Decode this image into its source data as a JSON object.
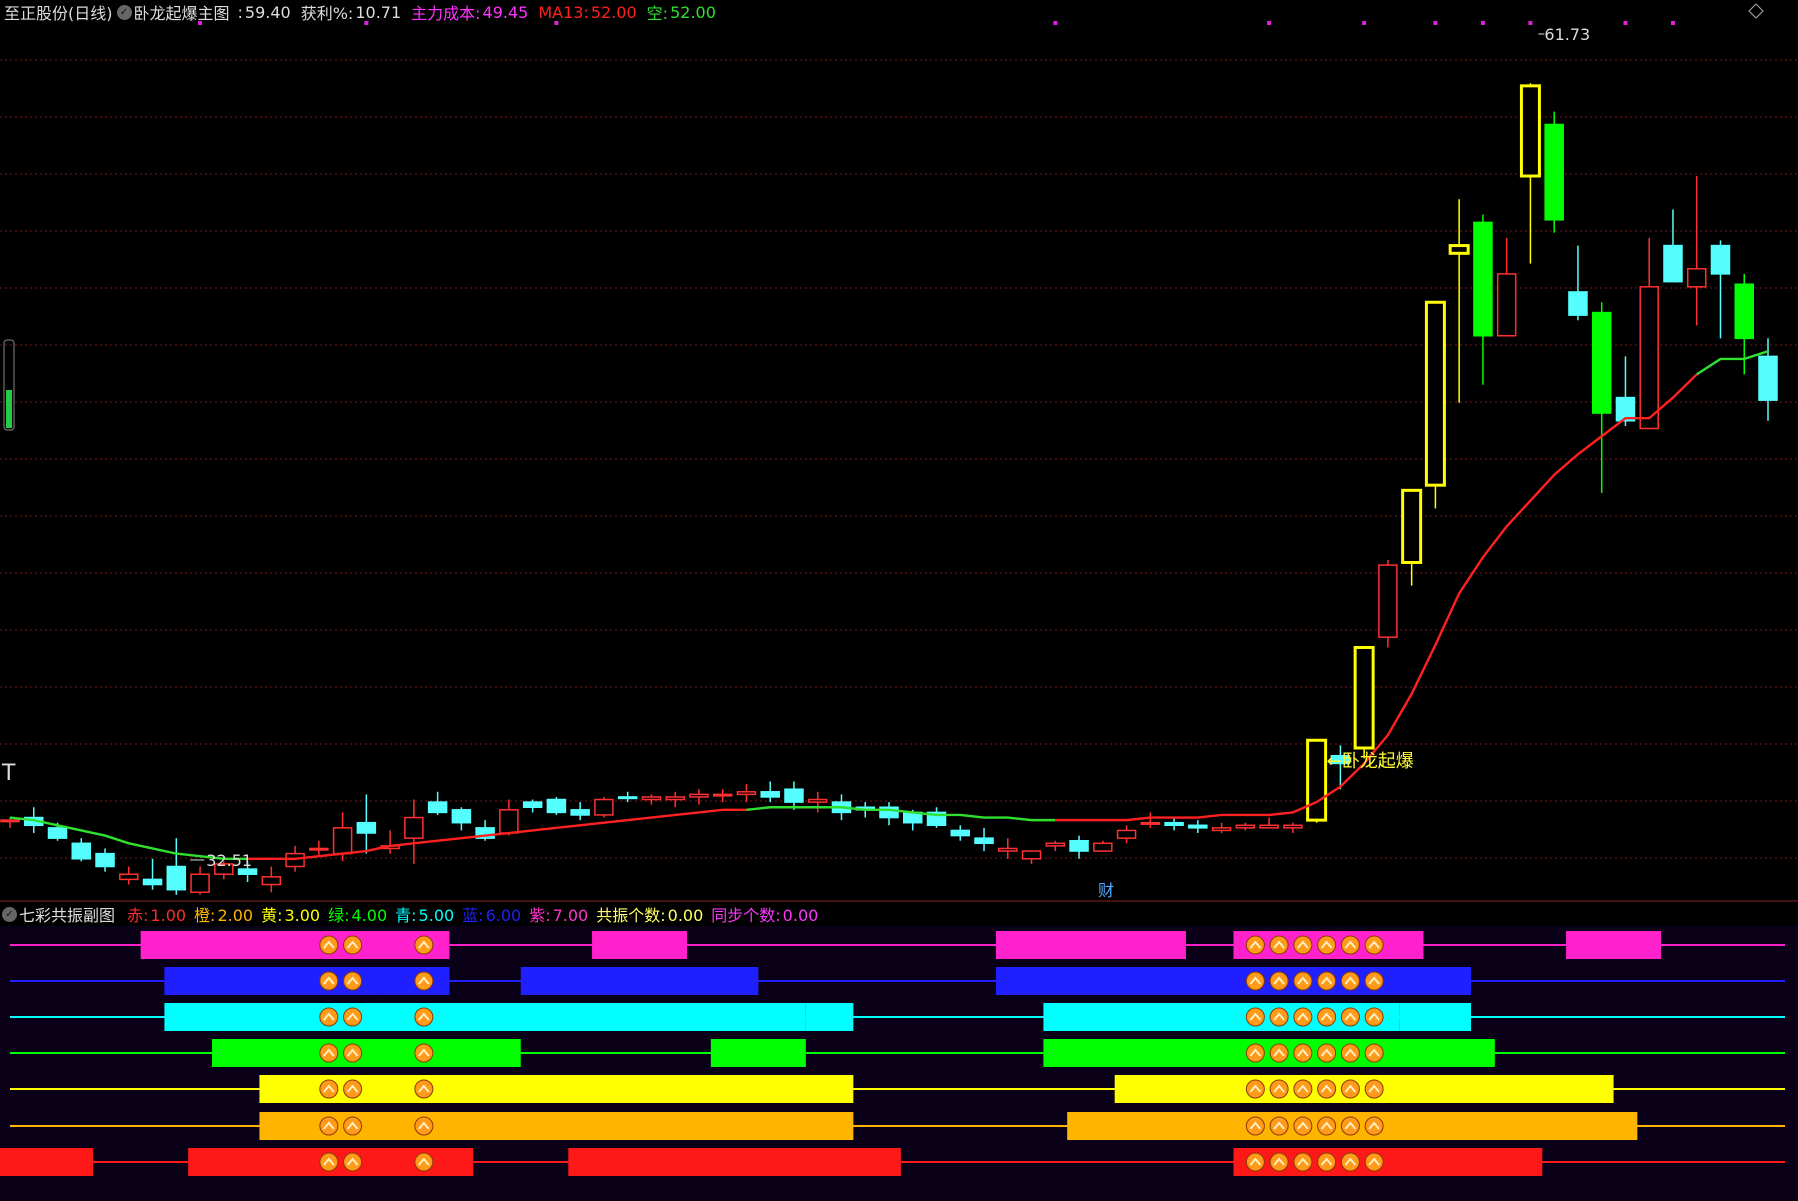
{
  "main_header": {
    "stock": "至正股份(日线)",
    "indicator_name": "卧龙起爆主图",
    "price_label": ":",
    "price_value": "59.40",
    "profit_label": "获利%:",
    "profit_value": "10.71",
    "cost_label": "主力成本:",
    "cost_value": "49.45",
    "ma_label": "MA13:",
    "ma_value": "52.00",
    "empty_label": "空:",
    "empty_value": "52.00"
  },
  "annotations": {
    "high_price": "61.73",
    "low_price": "32.51",
    "signal": "←卧龙起爆",
    "cai_marker": "财",
    "left_marker": "T"
  },
  "sub_header": {
    "indicator_name": "七彩共振副图",
    "items": [
      {
        "label": "赤:",
        "value": "1.00",
        "color": "#ff2a2a"
      },
      {
        "label": "橙:",
        "value": "2.00",
        "color": "#ffb400"
      },
      {
        "label": "黄:",
        "value": "3.00",
        "color": "#ffff00"
      },
      {
        "label": "绿:",
        "value": "4.00",
        "color": "#00ff00"
      },
      {
        "label": "青:",
        "value": "5.00",
        "color": "#00ffff"
      },
      {
        "label": "蓝:",
        "value": "6.00",
        "color": "#1f1fff"
      },
      {
        "label": "紫:",
        "value": "7.00",
        "color": "#ff33cc"
      },
      {
        "label": "共振个数:",
        "value": "0.00",
        "color": "#ffff66"
      },
      {
        "label": "同步个数:",
        "value": "0.00",
        "color": "#ff33ff"
      }
    ]
  },
  "colors": {
    "up": "#ff3030",
    "down": "#55ffff",
    "signal": "#ffff00",
    "strong_down": "#00ff00",
    "ma_up": "#ff2020",
    "ma_down": "#2fe02f",
    "grid": "#7a1a1a",
    "sub_bg": "#0a0018"
  },
  "chart_data": {
    "type": "candlestick",
    "y_range": [
      30,
      64
    ],
    "candles": [
      [
        33.1,
        33.2,
        32.8,
        33.1,
        "f"
      ],
      [
        33.2,
        33.6,
        32.6,
        32.9,
        "d"
      ],
      [
        32.8,
        33.0,
        32.3,
        32.4,
        "d"
      ],
      [
        32.2,
        32.4,
        31.5,
        31.6,
        "d"
      ],
      [
        31.8,
        32.0,
        31.1,
        31.3,
        "d"
      ],
      [
        30.8,
        31.3,
        30.6,
        31.0,
        "u"
      ],
      [
        30.6,
        31.6,
        30.4,
        30.8,
        "d"
      ],
      [
        31.3,
        32.4,
        30.2,
        30.4,
        "d"
      ],
      [
        30.3,
        31.3,
        30.2,
        31.0,
        "u"
      ],
      [
        31.0,
        31.5,
        30.8,
        31.4,
        "u"
      ],
      [
        31.2,
        31.5,
        30.7,
        31.0,
        "d"
      ],
      [
        30.6,
        31.3,
        30.3,
        30.9,
        "u"
      ],
      [
        31.3,
        32.1,
        31.1,
        31.8,
        "u"
      ],
      [
        32.0,
        32.3,
        31.7,
        32.0,
        "f"
      ],
      [
        31.8,
        33.4,
        31.5,
        32.8,
        "u"
      ],
      [
        32.6,
        34.1,
        31.8,
        33.0,
        "d"
      ],
      [
        32.0,
        32.7,
        31.8,
        32.1,
        "u"
      ],
      [
        32.4,
        33.9,
        31.4,
        33.2,
        "u"
      ],
      [
        33.8,
        34.2,
        33.3,
        33.4,
        "d"
      ],
      [
        33.5,
        33.6,
        32.7,
        33.0,
        "d"
      ],
      [
        32.8,
        33.1,
        32.3,
        32.4,
        "d"
      ],
      [
        32.6,
        33.9,
        32.5,
        33.5,
        "u"
      ],
      [
        33.8,
        33.9,
        33.4,
        33.6,
        "d"
      ],
      [
        33.9,
        34.0,
        33.3,
        33.4,
        "d"
      ],
      [
        33.5,
        33.8,
        33.1,
        33.3,
        "d"
      ],
      [
        33.3,
        34.0,
        33.2,
        33.9,
        "u"
      ],
      [
        34.0,
        34.2,
        33.8,
        34.0,
        "d"
      ],
      [
        33.9,
        34.1,
        33.7,
        34.0,
        "u"
      ],
      [
        33.9,
        34.2,
        33.6,
        34.0,
        "f"
      ],
      [
        34.0,
        34.3,
        33.7,
        34.1,
        "f"
      ],
      [
        34.1,
        34.3,
        33.8,
        34.1,
        "f"
      ],
      [
        34.1,
        34.5,
        33.8,
        34.2,
        "f"
      ],
      [
        34.2,
        34.6,
        33.8,
        34.0,
        "d"
      ],
      [
        34.3,
        34.6,
        33.5,
        33.8,
        "d"
      ],
      [
        33.8,
        34.2,
        33.4,
        33.9,
        "u"
      ],
      [
        33.8,
        34.1,
        33.1,
        33.4,
        "d"
      ],
      [
        33.6,
        33.8,
        33.2,
        33.5,
        "f"
      ],
      [
        33.6,
        33.8,
        32.9,
        33.2,
        "d"
      ],
      [
        33.4,
        33.5,
        32.7,
        33.0,
        "f"
      ],
      [
        33.4,
        33.6,
        32.8,
        32.9,
        "d"
      ],
      [
        32.7,
        32.9,
        32.3,
        32.5,
        "d"
      ],
      [
        32.4,
        32.8,
        31.9,
        32.2,
        "f"
      ],
      [
        31.9,
        32.4,
        31.6,
        32.0,
        "f"
      ],
      [
        31.6,
        31.9,
        31.4,
        31.9,
        "u"
      ],
      [
        32.2,
        32.3,
        31.9,
        32.1,
        "u"
      ],
      [
        32.3,
        32.5,
        31.6,
        31.9,
        "d"
      ],
      [
        31.9,
        32.3,
        31.9,
        32.2,
        "u"
      ],
      [
        32.4,
        32.9,
        32.2,
        32.7,
        "u"
      ],
      [
        33.0,
        33.4,
        32.8,
        33.0,
        "f"
      ],
      [
        33.0,
        33.2,
        32.7,
        32.9,
        "f"
      ],
      [
        32.9,
        33.1,
        32.6,
        32.8,
        "d"
      ],
      [
        32.7,
        33.0,
        32.6,
        32.8,
        "f"
      ],
      [
        32.8,
        33.0,
        32.7,
        32.9,
        "u"
      ],
      [
        32.8,
        33.2,
        32.8,
        32.9,
        "f"
      ],
      [
        32.8,
        33.0,
        32.6,
        32.9,
        "f"
      ],
      [
        33.1,
        36.2,
        33.0,
        36.2,
        "s"
      ],
      [
        35.3,
        36.0,
        34.3,
        35.6,
        "d"
      ],
      [
        35.9,
        39.8,
        35.5,
        39.8,
        "s"
      ],
      [
        40.2,
        43.2,
        39.8,
        43.0,
        "u"
      ],
      [
        43.1,
        45.9,
        42.2,
        45.9,
        "s"
      ],
      [
        46.1,
        53.2,
        45.2,
        53.2,
        "s"
      ],
      [
        55.4,
        57.2,
        49.3,
        55.1,
        "s"
      ],
      [
        56.3,
        56.6,
        50.0,
        51.9,
        "g"
      ],
      [
        51.9,
        55.7,
        51.9,
        54.3,
        "u"
      ],
      [
        58.1,
        61.7,
        54.7,
        61.6,
        "s"
      ],
      [
        60.1,
        60.6,
        55.9,
        56.4,
        "g"
      ],
      [
        53.6,
        55.4,
        52.5,
        52.7,
        "d"
      ],
      [
        52.8,
        53.2,
        45.8,
        48.9,
        "g"
      ],
      [
        49.5,
        51.1,
        48.4,
        48.6,
        "d"
      ],
      [
        48.3,
        55.7,
        48.3,
        53.8,
        "u"
      ],
      [
        55.4,
        56.8,
        54.0,
        54.0,
        "d"
      ],
      [
        53.8,
        58.1,
        52.3,
        54.5,
        "u"
      ],
      [
        55.4,
        55.6,
        51.8,
        54.3,
        "d"
      ],
      [
        53.9,
        54.3,
        50.4,
        51.8,
        "g"
      ],
      [
        51.1,
        51.8,
        48.6,
        49.4,
        "d"
      ]
    ],
    "ma": [
      33.2,
      33.1,
      32.9,
      32.7,
      32.5,
      32.2,
      32.0,
      31.8,
      31.7,
      31.6,
      31.6,
      31.6,
      31.6,
      31.7,
      31.8,
      31.9,
      32.1,
      32.2,
      32.3,
      32.4,
      32.5,
      32.6,
      32.7,
      32.8,
      32.9,
      33.0,
      33.1,
      33.2,
      33.3,
      33.4,
      33.5,
      33.5,
      33.6,
      33.6,
      33.6,
      33.6,
      33.5,
      33.5,
      33.4,
      33.3,
      33.3,
      33.2,
      33.2,
      33.1,
      33.1,
      33.1,
      33.1,
      33.1,
      33.2,
      33.2,
      33.2,
      33.3,
      33.3,
      33.3,
      33.4,
      33.8,
      34.4,
      35.3,
      36.4,
      38.0,
      39.9,
      41.9,
      43.3,
      44.5,
      45.5,
      46.5,
      47.3,
      48.0,
      48.7,
      48.7,
      49.5,
      50.4,
      51.0,
      51.0,
      51.3
    ],
    "ma_segments": [
      {
        "from": 0,
        "to": 10,
        "dir": "down"
      },
      {
        "from": 10,
        "to": 31,
        "dir": "up"
      },
      {
        "from": 31,
        "to": 44,
        "dir": "down"
      },
      {
        "from": 44,
        "to": 71,
        "dir": "up"
      },
      {
        "from": 71,
        "to": 74,
        "dir": "down"
      }
    ],
    "top_dots_index": [
      8,
      15,
      23,
      44,
      53,
      57,
      60,
      62,
      64,
      68,
      70
    ],
    "high_marker_index": 64,
    "low_marker_index": 7,
    "signal_index": 55,
    "resonance_lines": [
      {
        "name": "紫",
        "color": "#ff22cc",
        "blocks": [
          [
            6,
            16
          ],
          [
            17,
            18
          ],
          [
            25,
            28
          ],
          [
            42,
            49
          ],
          [
            52,
            59
          ],
          [
            66,
            69
          ]
        ]
      },
      {
        "name": "蓝",
        "color": "#1f1fff",
        "blocks": [
          [
            7,
            16
          ],
          [
            16,
            18
          ],
          [
            22,
            31
          ],
          [
            42,
            61
          ]
        ]
      },
      {
        "name": "青",
        "color": "#00ffff",
        "blocks": [
          [
            7,
            33
          ],
          [
            34,
            35
          ],
          [
            44,
            58
          ],
          [
            59,
            61
          ]
        ]
      },
      {
        "name": "绿",
        "color": "#00ff00",
        "blocks": [
          [
            9,
            21
          ],
          [
            30,
            33
          ],
          [
            44,
            62
          ]
        ]
      },
      {
        "name": "黄",
        "color": "#ffff00",
        "blocks": [
          [
            11,
            35
          ],
          [
            47,
            67
          ]
        ]
      },
      {
        "name": "橙",
        "color": "#ffb400",
        "blocks": [
          [
            11,
            35
          ],
          [
            45,
            68
          ]
        ]
      },
      {
        "name": "赤",
        "color": "#ff1818",
        "blocks": [
          [
            0,
            3
          ],
          [
            8,
            12
          ],
          [
            13,
            19
          ],
          [
            24,
            26
          ],
          [
            26,
            30
          ],
          [
            30,
            37
          ],
          [
            52,
            64
          ]
        ]
      }
    ],
    "resonance_icon_groups": [
      [
        13,
        14
      ],
      [
        17
      ],
      [
        52,
        53,
        54,
        55,
        56,
        57
      ]
    ]
  }
}
